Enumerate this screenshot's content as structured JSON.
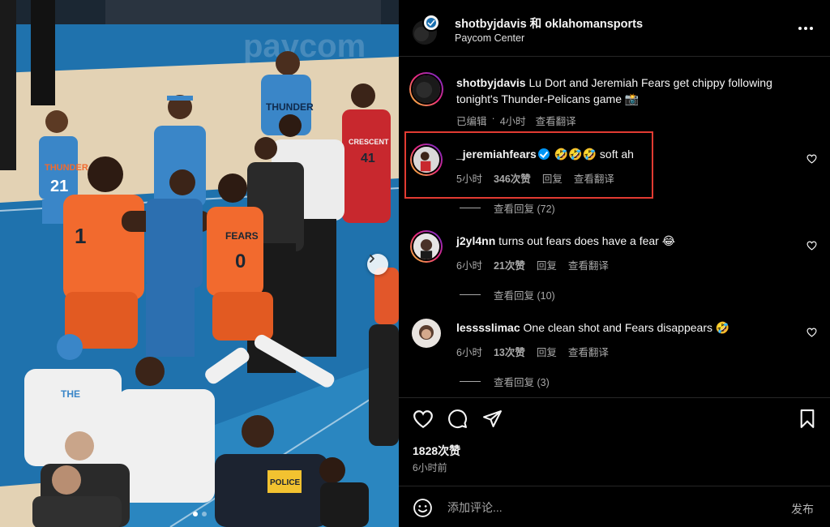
{
  "post": {
    "authors": "shotbyjdavis 和 oklahomansports",
    "location": "Paycom Center",
    "likes": "1828次赞",
    "time": "6小时前",
    "comment_placeholder": "添加评论...",
    "post_label": "发布",
    "photo": {
      "arena_sign": "paycom",
      "jerseys": {
        "thunder": "THUNDER",
        "crescent": "CRESCENT",
        "fears": "FEARS",
        "police": "POLICE"
      },
      "numbers": {
        "thunder_left": "21",
        "crescent": "41",
        "fears": "0",
        "orange_left": "1"
      }
    }
  },
  "caption": {
    "user": "shotbyjdavis",
    "text": " Lu Dort and Jeremiah Fears get chippy following tonight's Thunder-Pelicans game 📸",
    "edited": "已编辑",
    "age": "4小时",
    "translate": "查看翻译"
  },
  "comments": [
    {
      "user": "_jeremiahfears",
      "text": " 🤣🤣🤣 soft ah",
      "age": "5小时",
      "likes": "346次赞",
      "reply": "回复",
      "translate": "查看翻译",
      "view_replies": "查看回复 (72)"
    },
    {
      "user": "j2yl4nn",
      "text": " turns out fears does have a fear 😂",
      "age": "6小时",
      "likes": "21次赞",
      "reply": "回复",
      "translate": "查看翻译",
      "view_replies": "查看回复 (10)"
    },
    {
      "user": "lesssslimac",
      "text": " One clean shot and Fears disappears 🤣",
      "age": "6小时",
      "likes": "13次赞",
      "reply": "回复",
      "translate": "查看翻译",
      "view_replies": "查看回复 (3)"
    }
  ],
  "colors": {
    "highlight": "#e23b32",
    "verified": "#0095f6",
    "thunder_blue": "#3a86c8",
    "pelicans_orange": "#f26a2e",
    "court_blue": "#1f72ad"
  },
  "icons": {
    "like": "heart-icon",
    "comment": "comment-icon",
    "share": "paper-plane-icon",
    "save": "bookmark-icon",
    "emoji": "smiley-icon",
    "more": "more-dots-icon",
    "next": "chevron-right-icon"
  }
}
